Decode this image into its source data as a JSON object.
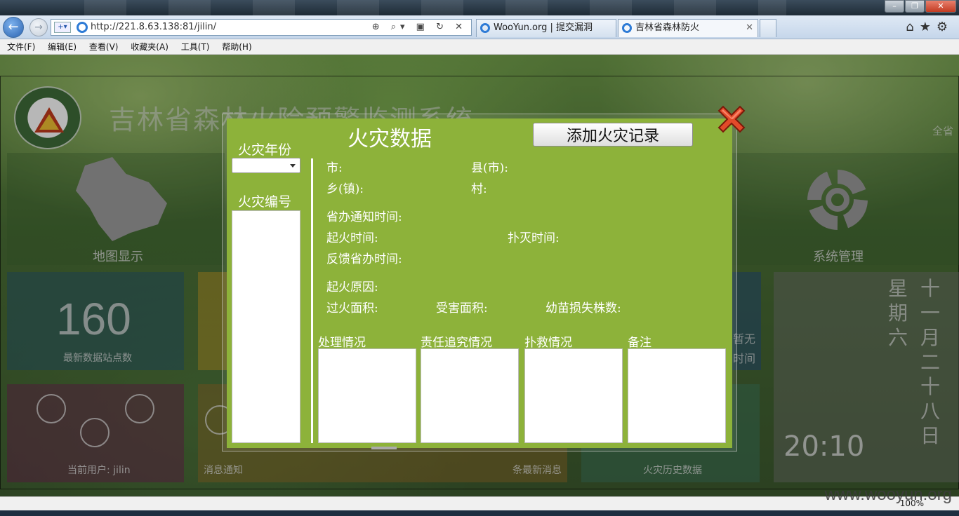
{
  "browser": {
    "address_url": "http://221.8.63.138:81/jilin/",
    "tabs": [
      {
        "label": "WooYun.org | 提交漏洞"
      },
      {
        "label": "吉林省森林防火"
      }
    ],
    "menu": [
      "文件(F)",
      "编辑(E)",
      "查看(V)",
      "收藏夹(A)",
      "工具(T)",
      "帮助(H)"
    ],
    "zoom": "100%"
  },
  "site": {
    "title": "吉林省森林火险预警监测系统",
    "region_link": "全省",
    "tiles": {
      "map_label": "地图显示",
      "system_label": "系统管理",
      "station_count": "160",
      "station_label": "最新数据站点数",
      "user_label": "当前用户: jilin",
      "msg_label": "消息通知",
      "msg_count_label": "条最新消息",
      "history_label": "火灾历史数据",
      "right_partial_1": "暂无",
      "right_partial_2": "时间",
      "weekday_chars": [
        "星",
        "期",
        "六"
      ],
      "date_chars": [
        "十",
        "一",
        "月",
        "二",
        "十",
        "八",
        "日"
      ],
      "clock": "20:10"
    }
  },
  "modal": {
    "title": "火灾数据",
    "add_button": "添加火灾记录",
    "year_label": "火灾年份",
    "id_label": "火灾编号",
    "fields": {
      "city": "市:",
      "county": "县(市):",
      "town": "乡(镇):",
      "village": "村:",
      "notify_time": "省办通知时间:",
      "start_time": "起火时间:",
      "extinguish_time": "扑灭时间:",
      "feedback_time": "反馈省办时间:",
      "cause": "起火原因:",
      "burned_area": "过火面积:",
      "damaged_area": "受害面积:",
      "seedling_loss": "幼苗损失株数:"
    },
    "text_areas": [
      "处理情况",
      "责任追究情况",
      "扑救情况",
      "备注"
    ]
  },
  "watermark": "www.wooyun.org"
}
